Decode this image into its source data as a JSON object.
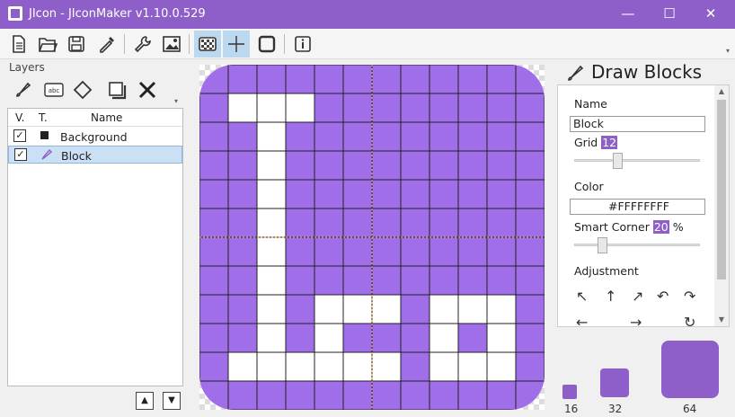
{
  "window": {
    "title": "JIcon - JIconMaker v1.10.0.529",
    "minimize": "—",
    "maximize": "☐",
    "close": "✕"
  },
  "toolbar": {
    "buttons": [
      "new-file",
      "open-folder",
      "save",
      "eyedropper",
      "wrench",
      "image",
      "checker",
      "crosshair",
      "square",
      "info"
    ]
  },
  "layers": {
    "label": "Layers",
    "columns": {
      "v": "V.",
      "t": "T.",
      "name": "Name"
    },
    "rows": [
      {
        "name": "Background",
        "checked": "✓",
        "type_color": "#222222"
      },
      {
        "name": "Block",
        "checked": "✓",
        "type_color": "#8e5fc8"
      }
    ],
    "up": "▲",
    "down": "▼"
  },
  "canvas": {
    "grid": 12,
    "bg_color": "#a06ee8",
    "block_color": "#ffffff",
    "line_color": "#222222",
    "blocks": [
      [
        1,
        1
      ],
      [
        1,
        2
      ],
      [
        1,
        3
      ],
      [
        2,
        2
      ],
      [
        3,
        2
      ],
      [
        4,
        2
      ],
      [
        5,
        2
      ],
      [
        6,
        2
      ],
      [
        7,
        2
      ],
      [
        8,
        2
      ],
      [
        9,
        2
      ],
      [
        10,
        2
      ],
      [
        10,
        1
      ],
      [
        10,
        3
      ],
      [
        8,
        4
      ],
      [
        8,
        5
      ],
      [
        8,
        6
      ],
      [
        9,
        4
      ],
      [
        10,
        4
      ],
      [
        10,
        5
      ],
      [
        10,
        6
      ],
      [
        8,
        8
      ],
      [
        8,
        9
      ],
      [
        8,
        10
      ],
      [
        9,
        8
      ],
      [
        9,
        10
      ],
      [
        10,
        8
      ],
      [
        10,
        9
      ],
      [
        10,
        10
      ]
    ]
  },
  "side": {
    "title": "Draw Blocks",
    "name_label": "Name",
    "name_value": "Block",
    "grid_label": "Grid",
    "grid_value": "12",
    "color_label": "Color",
    "color_value": "#FFFFFFFF",
    "corner_label": "Smart Corner",
    "corner_value": "20",
    "corner_unit": "%",
    "adjust_label": "Adjustment",
    "arrows": [
      "↖",
      "↑",
      "↗",
      "↶",
      "↷",
      "←",
      "→",
      "↻"
    ],
    "grid_slider": 0.33,
    "corner_slider": 0.2
  },
  "previews": [
    {
      "size": "16"
    },
    {
      "size": "32"
    },
    {
      "size": "64"
    }
  ],
  "accent": "#8e5fc8"
}
